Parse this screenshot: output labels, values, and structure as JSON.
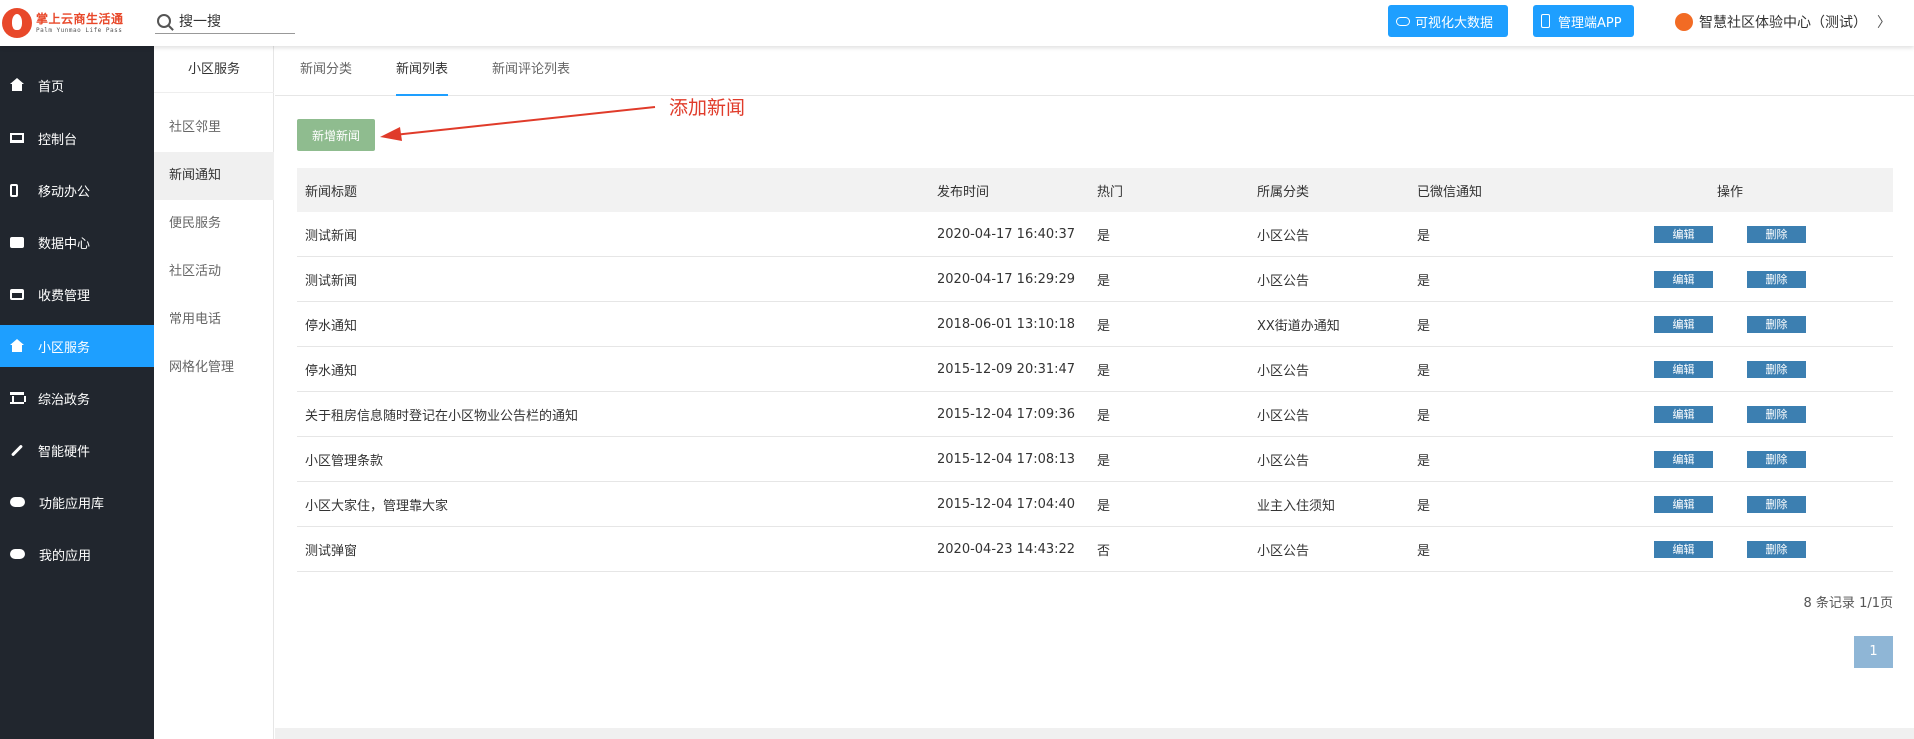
{
  "header": {
    "logo_cn": "掌上云商生活通",
    "logo_en": "Palm Yunmao Life Pass",
    "search_value": "搜一搜",
    "btn_bigdata": "可视化大数据",
    "btn_app": "管理端APP",
    "user_name": "智慧社区体验中心（测试）",
    "user_chevron": "〉"
  },
  "nav": [
    {
      "label": "首页"
    },
    {
      "label": "控制台"
    },
    {
      "label": "移动办公"
    },
    {
      "label": "数据中心"
    },
    {
      "label": "收费管理"
    },
    {
      "label": "小区服务"
    },
    {
      "label": "综治政务"
    },
    {
      "label": "智能硬件"
    },
    {
      "label": "功能应用库"
    },
    {
      "label": "我的应用"
    }
  ],
  "submenu": {
    "title": "小区服务",
    "items": [
      {
        "label": "社区邻里"
      },
      {
        "label": "新闻通知"
      },
      {
        "label": "便民服务"
      },
      {
        "label": "社区活动"
      },
      {
        "label": "常用电话"
      },
      {
        "label": "网格化管理"
      }
    ]
  },
  "tabs": [
    {
      "label": "新闻分类"
    },
    {
      "label": "新闻列表"
    },
    {
      "label": "新闻评论列表"
    }
  ],
  "main": {
    "add_button": "新增新闻",
    "annotation": "添加新闻"
  },
  "table": {
    "headers": [
      "新闻标题",
      "发布时间",
      "热门",
      "所属分类",
      "已微信通知",
      "操作"
    ],
    "edit_label": "编辑",
    "delete_label": "删除",
    "rows": [
      {
        "title": "测试新闻",
        "time": "2020-04-17 16:40:37",
        "hot": "是",
        "category": "小区公告",
        "wechat": "是"
      },
      {
        "title": "测试新闻",
        "time": "2020-04-17 16:29:29",
        "hot": "是",
        "category": "小区公告",
        "wechat": "是"
      },
      {
        "title": "停水通知",
        "time": "2018-06-01 13:10:18",
        "hot": "是",
        "category": "XX街道办通知",
        "wechat": "是"
      },
      {
        "title": "停水通知",
        "time": "2015-12-09 20:31:47",
        "hot": "是",
        "category": "小区公告",
        "wechat": "是"
      },
      {
        "title": "关于租房信息随时登记在小区物业公告栏的通知",
        "time": "2015-12-04 17:09:36",
        "hot": "是",
        "category": "小区公告",
        "wechat": "是"
      },
      {
        "title": "小区管理条款",
        "time": "2015-12-04 17:08:13",
        "hot": "是",
        "category": "小区公告",
        "wechat": "是"
      },
      {
        "title": "小区大家住，管理靠大家",
        "time": "2015-12-04 17:04:40",
        "hot": "是",
        "category": "业主入住须知",
        "wechat": "是"
      },
      {
        "title": "测试弹窗",
        "time": "2020-04-23 14:43:22",
        "hot": "否",
        "category": "小区公告",
        "wechat": "是"
      }
    ]
  },
  "pagination": {
    "records": "8 条记录 1/1页",
    "current_page": "1"
  },
  "colors": {
    "accent": "#1e9fff",
    "nav_bg": "#21262e",
    "add_button": "#8fbc8f",
    "op_button": "#3c7fb1",
    "annotation": "#e03b2a"
  }
}
